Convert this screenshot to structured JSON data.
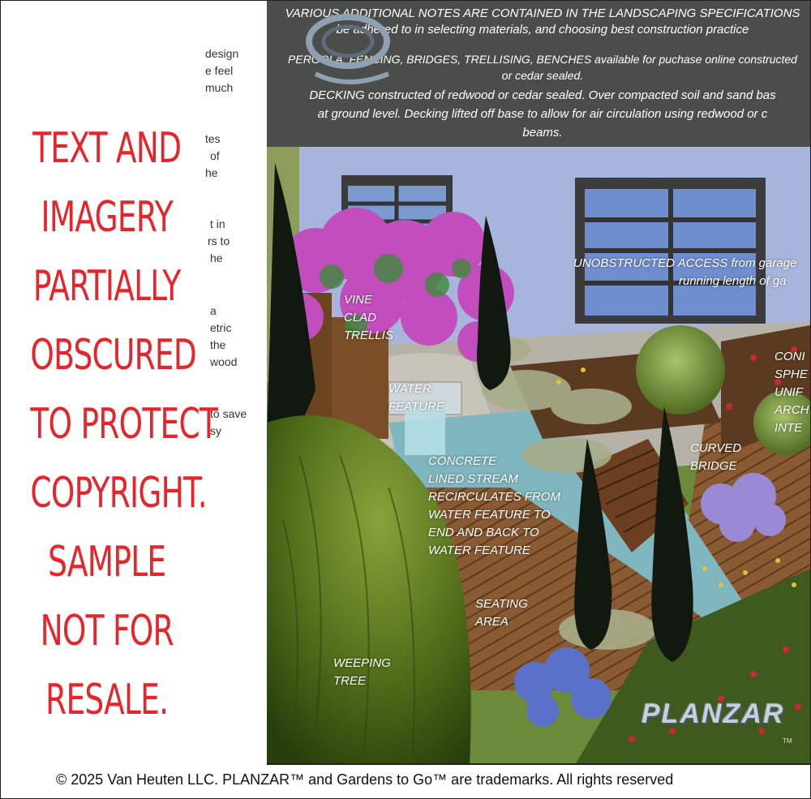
{
  "left_panel": {
    "fragments": [
      "design",
      "e feel",
      "much",
      "tes",
      "of",
      "he",
      "t in",
      "rs to",
      "he",
      "a",
      "etric",
      "the",
      "wood",
      "to save",
      "sy"
    ],
    "watermark_lines": [
      "TEXT AND",
      "IMAGERY",
      "PARTIALLY",
      "OBSCURED",
      "TO PROTECT",
      "COPYRIGHT.",
      "SAMPLE",
      "NOT FOR",
      "RESALE."
    ]
  },
  "notes": {
    "line1": "VARIOUS ADDITIONAL NOTES ARE CONTAINED IN THE LANDSCAPING SPECIFICATIONS",
    "line2": "be adhered to in selecting materials, and choosing best construction practice",
    "line3": "PERGOLA, FENCING, BRIDGES, TRELLISING, BENCHES available for puchase online constructed",
    "line4": "or cedar sealed.",
    "line5": "DECKING constructed of redwood or cedar sealed. Over compacted soil and sand bas",
    "line6": "at ground level. Decking lifted off base to allow for air circulation using redwood or c",
    "line7": "beams."
  },
  "labels": {
    "unobstructed_1": "UNOBSTRUCTED ACCESS from garage",
    "unobstructed_2": "running length of ga",
    "vine_1": "VINE",
    "vine_2": "CLAD",
    "vine_3": "TRELLIS",
    "conif_1": "CONI",
    "conif_2": "SPHE",
    "conif_3": "UNIF",
    "conif_4": "ARCH",
    "conif_5": "INTE",
    "water_1": "WATER",
    "water_2": "FEATURE",
    "curved_1": "CURVED",
    "curved_2": "BRIDGE",
    "concrete_1": "CONCRETE",
    "concrete_2": "LINED STREAM",
    "concrete_3": "RECIRCULATES FROM",
    "concrete_4": "WATER FEATURE TO",
    "concrete_5": "END AND BACK TO",
    "concrete_6": "WATER FEATURE",
    "seating_1": "SEATING",
    "seating_2": "AREA",
    "weeping_1": "WEEPING",
    "weeping_2": "TREE"
  },
  "logo": {
    "text": "PLANZAR",
    "tm": "TM"
  },
  "footer": "© 2025 Van Heuten LLC. PLANZAR™ and Gardens to Go™ are trademarks. All rights reserved",
  "colors": {
    "watermark": "#e8232a",
    "notes_bg": "#4b4d4a",
    "house_wall": "#a7b5dc"
  }
}
